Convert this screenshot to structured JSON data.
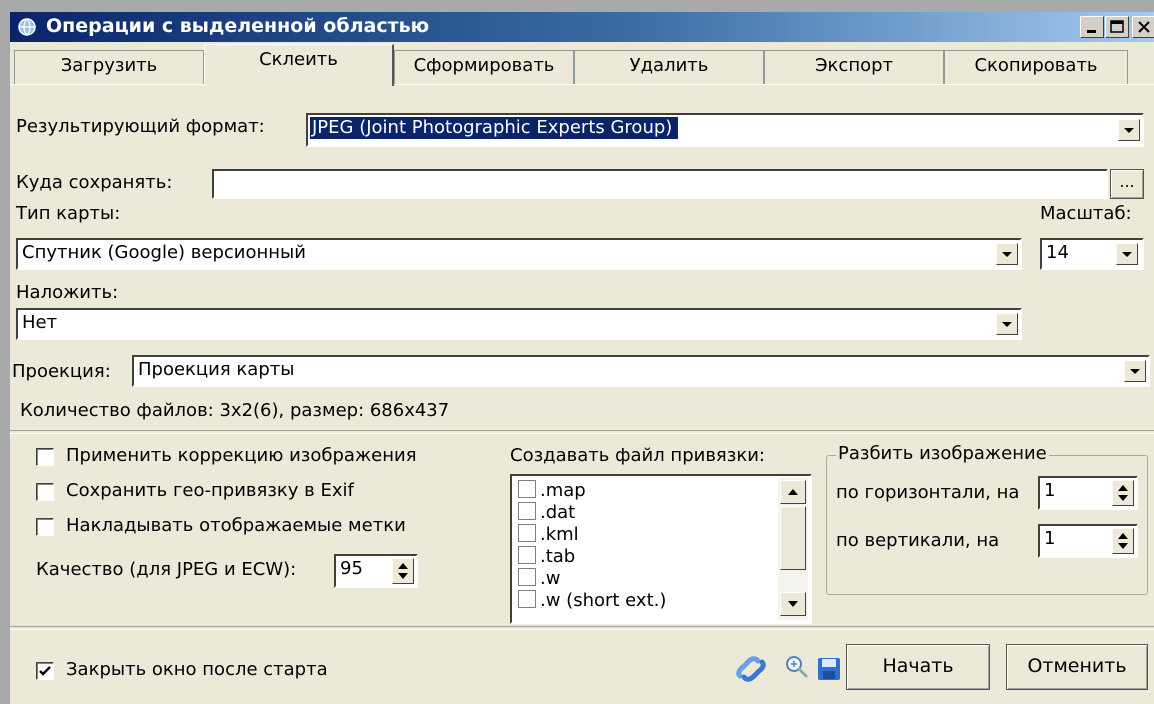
{
  "window": {
    "title": "Операции с выделенной областью"
  },
  "tabs": [
    "Загрузить",
    "Склеить",
    "Сформировать",
    "Удалить",
    "Экспорт",
    "Скопировать"
  ],
  "active_tab": "Склеить",
  "format": {
    "label": "Результирующий формат:",
    "value": "JPEG (Joint Photographic Experts Group)"
  },
  "save_to": {
    "label": "Куда сохранять:",
    "value": "",
    "browse": "..."
  },
  "map_type": {
    "label": "Тип карты:",
    "value": "Спутник (Google) версионный"
  },
  "scale": {
    "label": "Масштаб:",
    "value": "14"
  },
  "overlay": {
    "label": "Наложить:",
    "value": "Нет"
  },
  "projection": {
    "label": "Проекция:",
    "value": "Проекция карты"
  },
  "file_count": "Количество файлов: 3x2(6), размер: 686x437",
  "options": {
    "apply_correction": {
      "label": "Применить коррекцию изображения",
      "checked": false
    },
    "save_geo_exif": {
      "label": "Сохранить гео-привязку в Exif",
      "checked": false
    },
    "overlay_marks": {
      "label": "Накладывать отображаемые метки",
      "checked": false
    },
    "quality": {
      "label": "Качество (для JPEG и ECW):",
      "value": "95"
    }
  },
  "georef": {
    "label": "Создавать файл привязки:",
    "items": [
      ".map",
      ".dat",
      ".kml",
      ".tab",
      ".w",
      ".w (short ext.)"
    ]
  },
  "split": {
    "label": "Разбить изображение",
    "horizontal": {
      "label": "по горизонтали, на",
      "value": "1"
    },
    "vertical": {
      "label": "по вертикали, на",
      "value": "1"
    }
  },
  "close_after_start": {
    "label": "Закрыть окно после старта",
    "checked": true
  },
  "buttons": {
    "start": "Начать",
    "cancel": "Отменить"
  },
  "colors": {
    "titlebar": "#0a246a",
    "selection": "#0a246a",
    "dialog": "#ece9d8"
  }
}
